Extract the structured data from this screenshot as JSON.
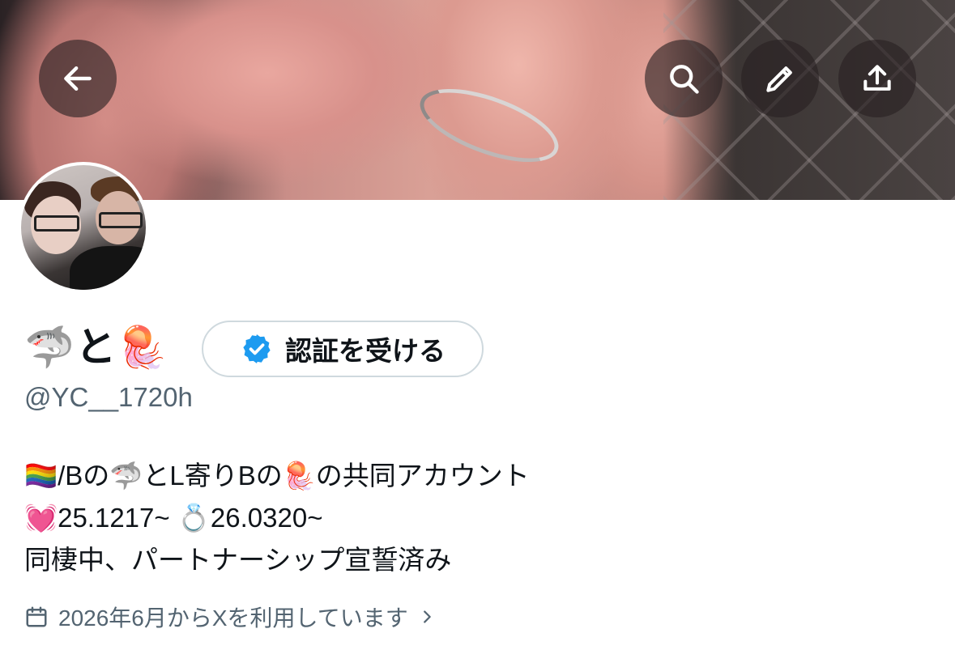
{
  "header": {
    "back_icon": "arrow-left-icon",
    "search_icon": "search-icon",
    "edit_icon": "pencil-icon",
    "share_icon": "share-upload-icon"
  },
  "profile": {
    "display_name": "🦈と🪼",
    "verify_button_label": "認証を受ける",
    "handle": "@YC__1720h",
    "bio_lines": [
      "🏳️‍🌈/Bの🦈とL寄りBの🪼の共同アカウント",
      "💓25.1217~ 💍26.0320~",
      "同棲中、パートナーシップ宣誓済み"
    ],
    "joined_text": "2026年6月からXを利用しています"
  },
  "colors": {
    "text_primary": "#0f1419",
    "text_secondary": "#536471",
    "verified_blue": "#1d9bf0",
    "button_border": "#cfd9de"
  }
}
